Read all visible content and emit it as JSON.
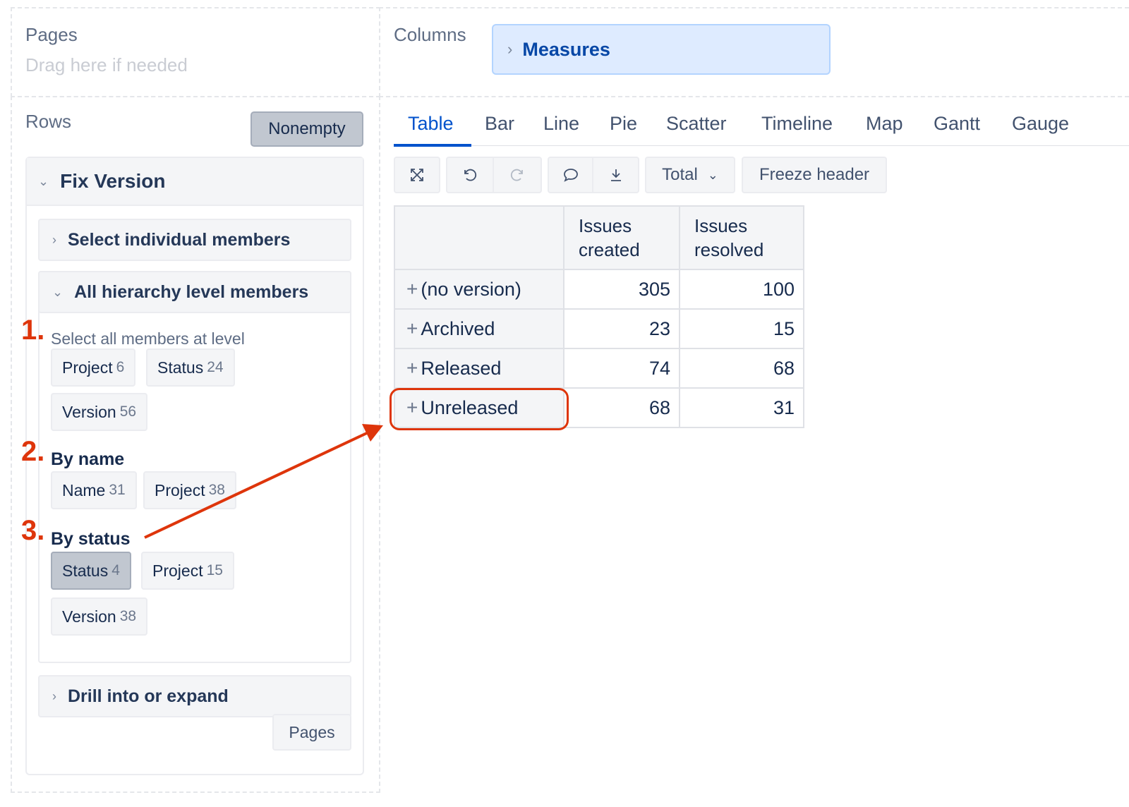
{
  "pages_area": {
    "title": "Pages",
    "hint": "Drag here if needed"
  },
  "columns_area": {
    "title": "Columns",
    "chip_label": "Measures"
  },
  "rows_area": {
    "title": "Rows",
    "nonempty_label": "Nonempty",
    "dimension": "Fix Version",
    "select_individual": "Select individual members",
    "all_hierarchy": "All hierarchy level members",
    "groups": [
      {
        "number": "1.",
        "title": "Select all members at level",
        "chips": [
          {
            "label": "Project",
            "count": "6"
          },
          {
            "label": "Status",
            "count": "24"
          },
          {
            "label": "Version",
            "count": "56"
          }
        ]
      },
      {
        "number": "2.",
        "title": "By name",
        "chips": [
          {
            "label": "Name",
            "count": "31"
          },
          {
            "label": "Project",
            "count": "38"
          }
        ]
      },
      {
        "number": "3.",
        "title": "By status",
        "chips": [
          {
            "label": "Status",
            "count": "4",
            "selected": true
          },
          {
            "label": "Project",
            "count": "15"
          },
          {
            "label": "Version",
            "count": "38"
          }
        ]
      }
    ],
    "drill": "Drill into or expand",
    "pages_button": "Pages"
  },
  "tabs": [
    {
      "label": "Table",
      "active": true
    },
    {
      "label": "Bar"
    },
    {
      "label": "Line"
    },
    {
      "label": "Pie"
    },
    {
      "label": "Scatter"
    },
    {
      "label": "Timeline"
    },
    {
      "label": "Map"
    },
    {
      "label": "Gantt"
    },
    {
      "label": "Gauge"
    }
  ],
  "toolbar": {
    "icons": [
      "fullscreen-icon",
      "undo-icon",
      "redo-icon",
      "comment-icon",
      "download-icon"
    ],
    "total_label": "Total",
    "freeze_label": "Freeze header"
  },
  "table": {
    "headers": [
      "Issues created",
      "Issues resolved"
    ],
    "rows": [
      {
        "label": "(no version)",
        "created": "305",
        "resolved": "100"
      },
      {
        "label": "Archived",
        "created": "23",
        "resolved": "15"
      },
      {
        "label": "Released",
        "created": "74",
        "resolved": "68"
      },
      {
        "label": "Unreleased",
        "created": "68",
        "resolved": "31"
      }
    ]
  },
  "colors": {
    "accent": "#0052cc",
    "annotation": "#de350b",
    "chip_bg": "#deebff"
  }
}
